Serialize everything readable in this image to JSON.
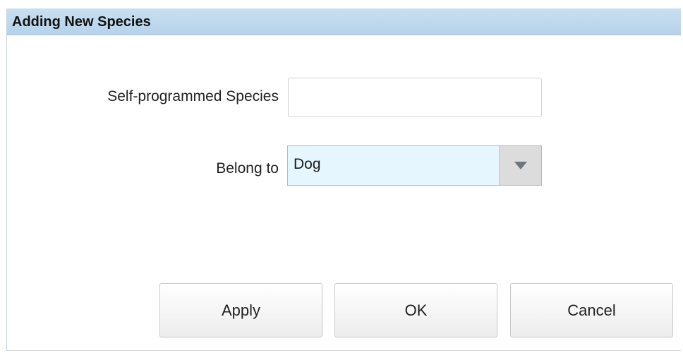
{
  "dialog": {
    "title": "Adding New Species"
  },
  "form": {
    "species_label": "Self-programmed Species",
    "species_value": "",
    "belong_label": "Belong to",
    "belong_value": "Dog"
  },
  "buttons": {
    "apply": "Apply",
    "ok": "OK",
    "cancel": "Cancel"
  },
  "icons": {
    "dropdown": "triangle-down-icon"
  },
  "colors": {
    "titlebar": "#b6d2ea",
    "select_background": "#e6f6ff",
    "select_border": "#8ec4e8",
    "arrow_button": "#dcdcdc"
  }
}
